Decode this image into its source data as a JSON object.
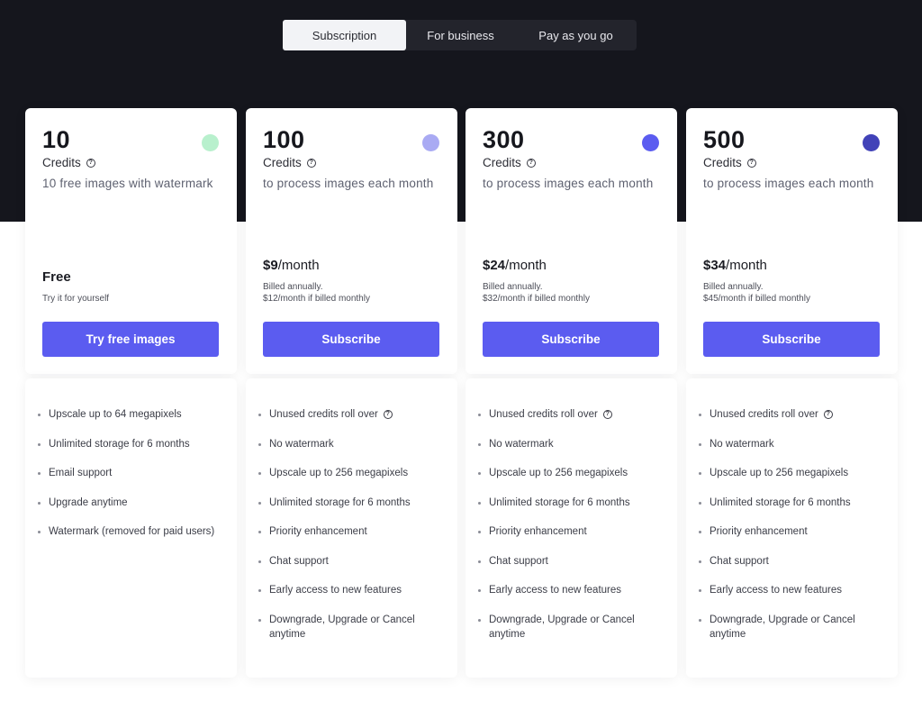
{
  "tabs": [
    "Subscription",
    "For business",
    "Pay as you go"
  ],
  "plans": [
    {
      "credits": "10",
      "credits_label": "Credits",
      "subtitle": "10 free images with watermark",
      "dot_color": "#b8f0cd",
      "price_amount": "Free",
      "price_period": "",
      "note_line1": "Try it for yourself",
      "note_line2": "",
      "cta": "Try free images",
      "features": [
        "Upscale up to 64 megapixels",
        "Unlimited storage for 6 months",
        "Email support",
        "Upgrade anytime",
        "Watermark (removed for paid users)"
      ]
    },
    {
      "credits": "100",
      "credits_label": "Credits",
      "subtitle": "to process images each month",
      "dot_color": "#a9aaf3",
      "price_amount": "$9",
      "price_period": "/month",
      "note_line1": "Billed annually.",
      "note_line2": "$12/month if billed monthly",
      "cta": "Subscribe",
      "features": [
        "Unused credits roll over",
        "No watermark",
        "Upscale up to 256 megapixels",
        "Unlimited storage for 6 months",
        "Priority enhancement",
        "Chat support",
        "Early access to new features",
        "Downgrade, Upgrade or Cancel anytime"
      ]
    },
    {
      "credits": "300",
      "credits_label": "Credits",
      "subtitle": "to process images each month",
      "dot_color": "#5b5cf0",
      "price_amount": "$24",
      "price_period": "/month",
      "note_line1": "Billed annually.",
      "note_line2": "$32/month if billed monthly",
      "cta": "Subscribe",
      "features": [
        "Unused credits roll over",
        "No watermark",
        "Upscale up to 256 megapixels",
        "Unlimited storage for 6 months",
        "Priority enhancement",
        "Chat support",
        "Early access to new features",
        "Downgrade, Upgrade or Cancel anytime"
      ]
    },
    {
      "credits": "500",
      "credits_label": "Credits",
      "subtitle": "to process images each month",
      "dot_color": "#4142b8",
      "price_amount": "$34",
      "price_period": "/month",
      "note_line1": "Billed annually.",
      "note_line2": "$45/month if billed monthly",
      "cta": "Subscribe",
      "features": [
        "Unused credits roll over",
        "No watermark",
        "Upscale up to 256 megapixels",
        "Unlimited storage for 6 months",
        "Priority enhancement",
        "Chat support",
        "Early access to new features",
        "Downgrade, Upgrade or Cancel anytime"
      ]
    }
  ]
}
